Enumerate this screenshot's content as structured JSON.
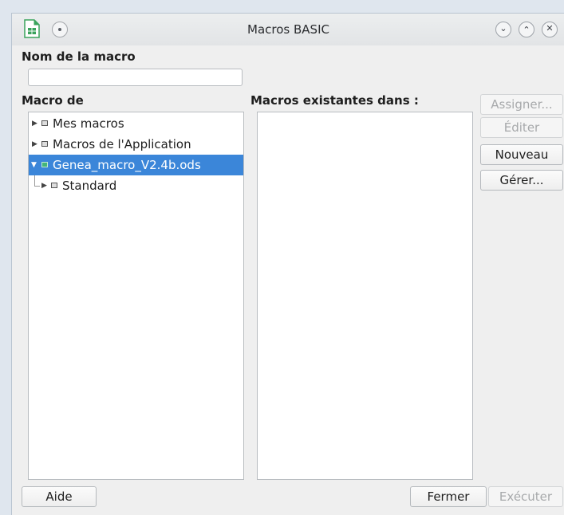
{
  "window": {
    "title": "Macros BASIC",
    "controls": [
      "minimize",
      "maximize",
      "close"
    ]
  },
  "macro_name": {
    "label": "Nom de la macro",
    "value": "",
    "placeholder": ""
  },
  "macro_from": {
    "label": "Macro de",
    "tree": [
      {
        "label": "Mes macros",
        "expanded": false,
        "selected": false,
        "level": 0
      },
      {
        "label": "Macros de l'Application",
        "expanded": false,
        "selected": false,
        "level": 0
      },
      {
        "label": "Genea_macro_V2.4b.ods",
        "expanded": true,
        "selected": true,
        "level": 0
      },
      {
        "label": "Standard",
        "expanded": false,
        "selected": false,
        "level": 1
      }
    ]
  },
  "existing_macros": {
    "label": "Macros existantes dans :",
    "items": []
  },
  "side_buttons": {
    "assign": "Assigner...",
    "edit": "Éditer",
    "new": "Nouveau",
    "manage": "Gérer..."
  },
  "bottom_buttons": {
    "help": "Aide",
    "close": "Fermer",
    "run": "Exécuter"
  },
  "colors": {
    "selection": "#3b86d9",
    "window_bg": "#efefef"
  }
}
